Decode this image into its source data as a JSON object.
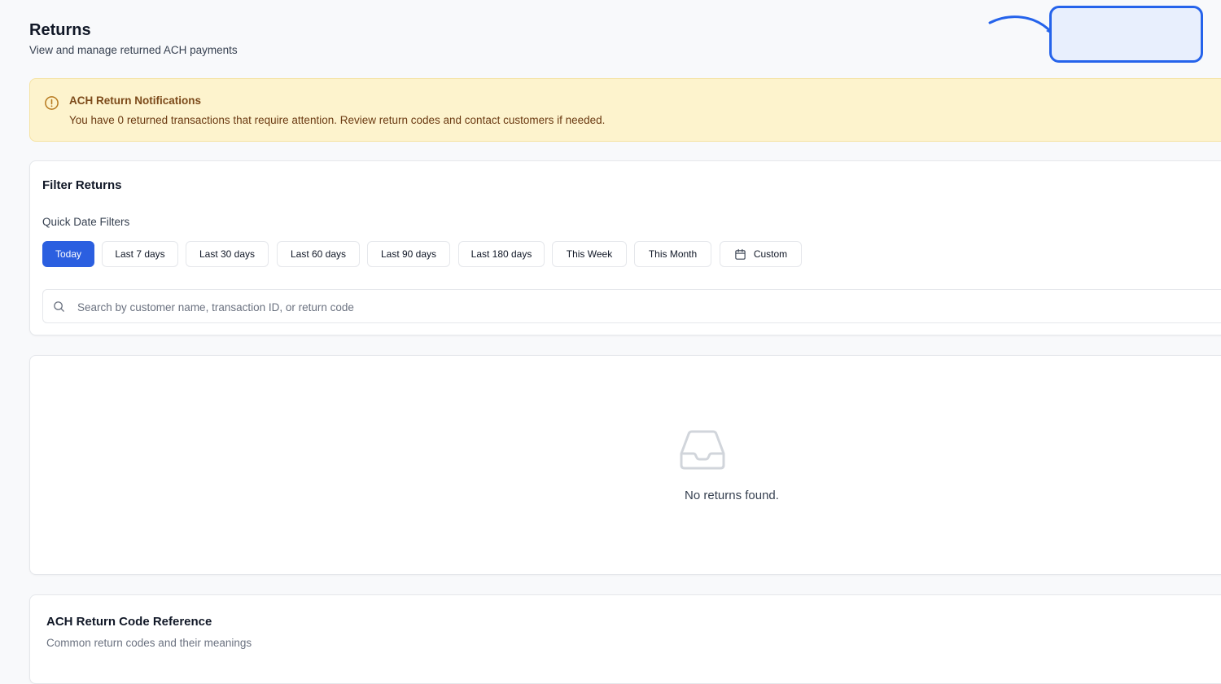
{
  "header": {
    "title": "Returns",
    "subtitle": "View and manage returned ACH payments"
  },
  "alert": {
    "title": "ACH Return Notifications",
    "message": "You have 0 returned transactions that require attention. Review return codes and contact customers if needed."
  },
  "filters": {
    "title": "Filter Returns",
    "quick_label": "Quick Date Filters",
    "chips": [
      "Today",
      "Last 7 days",
      "Last 30 days",
      "Last 60 days",
      "Last 90 days",
      "Last 180 days",
      "This Week",
      "This Month",
      "Custom"
    ],
    "active_chip": "Today",
    "search": {
      "value": "",
      "placeholder": "Search by customer name, transaction ID, or return code"
    }
  },
  "results": {
    "empty_message": "No returns found."
  },
  "reference": {
    "title": "ACH Return Code Reference",
    "subtitle": "Common return codes and their meanings"
  },
  "colors": {
    "accent": "#2b5fe0",
    "annotation": "#2563eb",
    "alert_bg": "#fdf3cd",
    "alert_text": "#7c4a1a"
  },
  "icons": [
    "alert-circle-icon",
    "calendar-icon",
    "search-icon",
    "inbox-icon",
    "annotation-arrow"
  ]
}
